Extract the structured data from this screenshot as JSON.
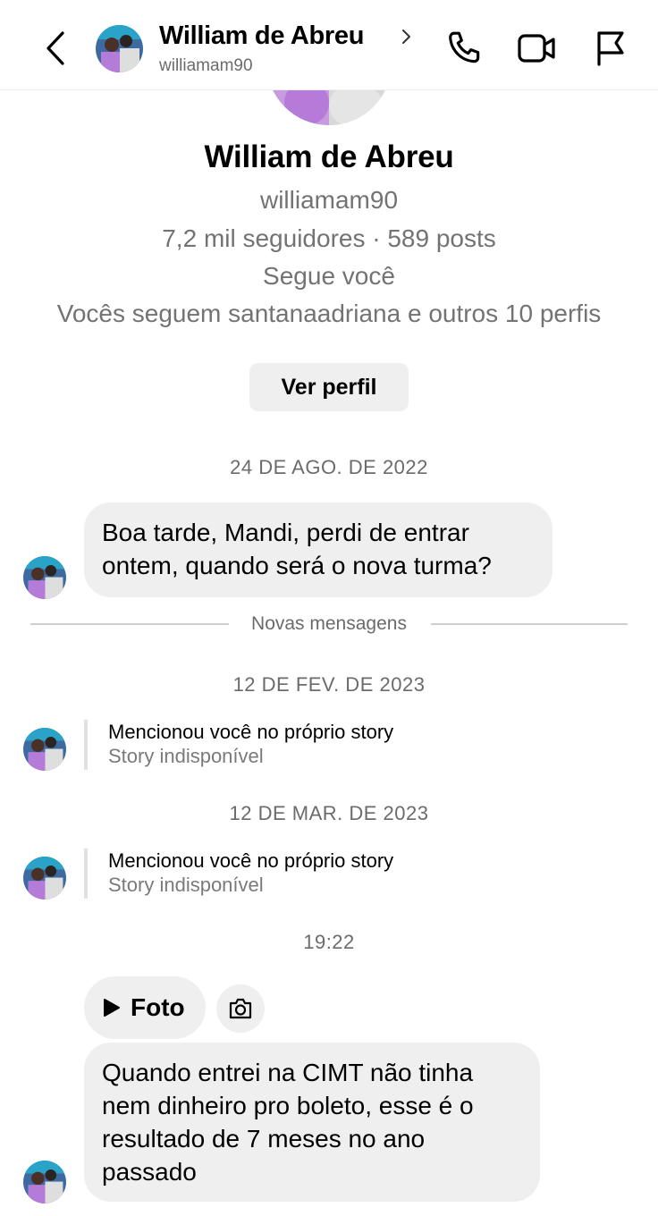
{
  "header": {
    "name": "William de Abreu",
    "username": "williamam90",
    "icons": [
      "back-icon",
      "chevron-right-icon",
      "phone-icon",
      "video-icon",
      "flag-icon"
    ]
  },
  "profile": {
    "name": "William de Abreu",
    "username": "williamam90",
    "stats": "7,2 mil seguidores · 589 posts",
    "follows_you": "Segue você",
    "mutual": "Vocês seguem santanaadriana e outros 10 perfis",
    "view_profile_button": "Ver perfil"
  },
  "messages": {
    "date1": "24 DE AGO. DE 2022",
    "msg1": "Boa tarde, Mandi, perdi de entrar ontem, quando será o nova turma?",
    "new_messages_divider": "Novas mensagens",
    "date2": "12 DE FEV. DE 2023",
    "story1_title": "Mencionou você no próprio story",
    "story1_sub": "Story indisponível",
    "date3": "12 DE MAR. DE 2023",
    "story2_title": "Mencionou você no próprio story",
    "story2_sub": "Story indisponível",
    "time4": "19:22",
    "photo_label": "Foto",
    "msg2": "Quando entrei na CIMT não tinha nem dinheiro pro boleto, esse é o resultado de 7 meses no ano passado"
  },
  "colors": {
    "bubble": "#efefef",
    "secondary_text": "#737373",
    "divider": "#cfcfcf"
  }
}
